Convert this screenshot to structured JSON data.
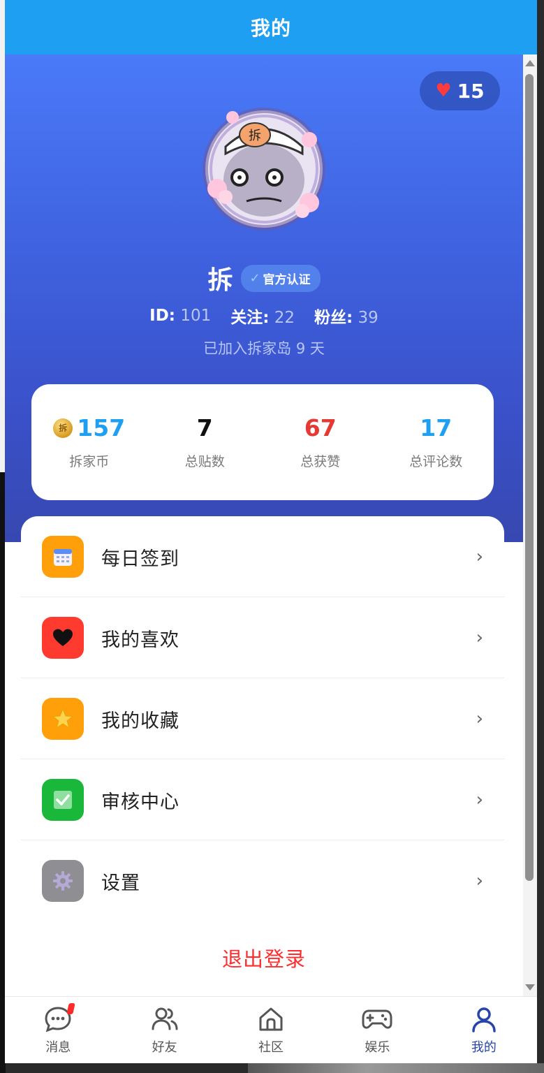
{
  "header": {
    "title": "我的"
  },
  "profile": {
    "likes_count": "15",
    "username": "拆",
    "avatar_text": "拆",
    "verified_label": "官方认证",
    "id_label": "ID:",
    "id_value": "101",
    "following_label": "关注:",
    "following_value": "22",
    "fans_label": "粉丝:",
    "fans_value": "39",
    "joined_text": "已加入拆家岛 9 天"
  },
  "stats": [
    {
      "value": "157",
      "label": "拆家币",
      "color": "#1e9ff2",
      "icon": "coin-icon"
    },
    {
      "value": "7",
      "label": "总贴数",
      "color": "#111111"
    },
    {
      "value": "67",
      "label": "总获赞",
      "color": "#e53935"
    },
    {
      "value": "17",
      "label": "总评论数",
      "color": "#1e9ff2"
    }
  ],
  "menu": [
    {
      "label": "每日签到",
      "icon": "calendar-icon",
      "color": "#ff9f0a"
    },
    {
      "label": "我的喜欢",
      "icon": "heart-icon",
      "color": "#ff3b30"
    },
    {
      "label": "我的收藏",
      "icon": "star-icon",
      "color": "#ff9f0a"
    },
    {
      "label": "审核中心",
      "icon": "checkbox-icon",
      "color": "#19b83a"
    },
    {
      "label": "设置",
      "icon": "gear-icon",
      "color": "#8e8e93"
    }
  ],
  "logout_label": "退出登录",
  "tabs": [
    {
      "label": "消息",
      "icon": "chat-icon",
      "badge": true
    },
    {
      "label": "好友",
      "icon": "friends-icon"
    },
    {
      "label": "社区",
      "icon": "home-icon"
    },
    {
      "label": "娱乐",
      "icon": "gamepad-icon"
    },
    {
      "label": "我的",
      "icon": "user-icon",
      "active": true
    }
  ]
}
